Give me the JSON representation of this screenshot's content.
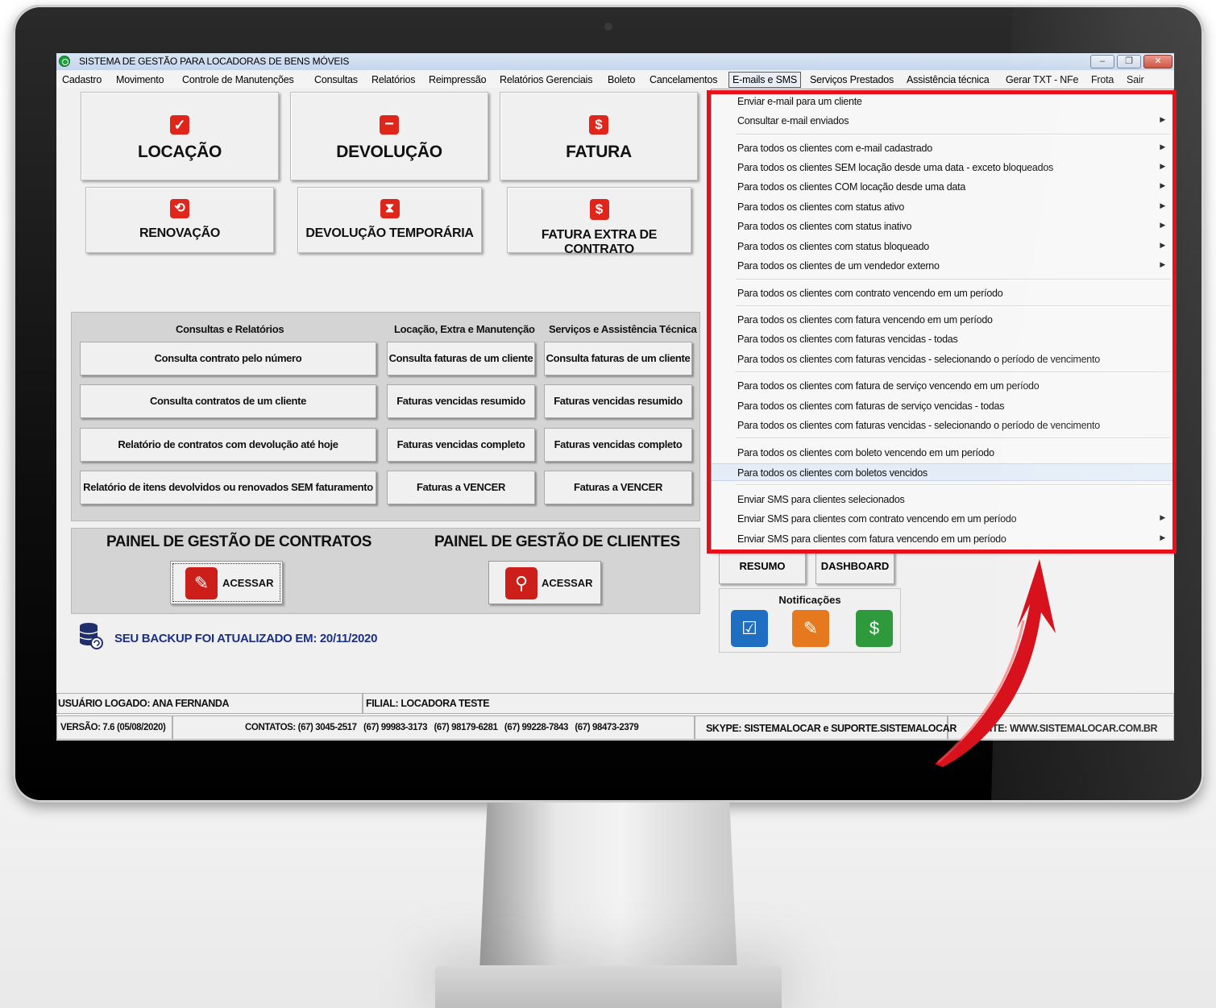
{
  "window": {
    "title": "SISTEMA DE GESTÃO PARA LOCADORAS DE BENS MÓVEIS"
  },
  "menu": [
    "Cadastro",
    "Movimento",
    "Controle de Manutenções",
    "Consultas",
    "Relatórios",
    "Reimpressão",
    "Relatórios Gerenciais",
    "Boleto",
    "Cancelamentos",
    "E-mails e SMS",
    "Serviços Prestados",
    "Assistência técnica",
    "Gerar TXT - NFe",
    "Frota",
    "Sair"
  ],
  "big_buttons": [
    "LOCAÇÃO",
    "DEVOLUÇÃO",
    "FATURA"
  ],
  "mid_buttons": [
    "RENOVAÇÃO",
    "DEVOLUÇÃO TEMPORÁRIA",
    "FATURA EXTRA DE CONTRATO"
  ],
  "icons_text": {
    "fatura": "$"
  },
  "consultas": {
    "columns": [
      "Consultas e Relatórios",
      "Locação, Extra e Manutenção",
      "Serviços e Assistência Técnica"
    ],
    "col1": [
      "Consulta contrato pelo número",
      "Consulta contratos de um cliente",
      "Relatório de contratos com devolução até hoje",
      "Relatório de itens devolvidos ou renovados SEM faturamento"
    ],
    "col2": [
      "Consulta faturas de um cliente",
      "Faturas vencidas resumido",
      "Faturas vencidas completo",
      "Faturas a VENCER"
    ],
    "col3": [
      "Consulta faturas de um cliente",
      "Faturas vencidas resumido",
      "Faturas vencidas completo",
      "Faturas a VENCER"
    ]
  },
  "panels": {
    "contratos_title": "PAINEL DE GESTÃO DE CONTRATOS",
    "clientes_title": "PAINEL DE GESTÃO DE CLIENTES",
    "access_label": "ACESSAR"
  },
  "backup": "SEU BACKUP FOI ATUALIZADO EM: 20/11/2020",
  "side": {
    "resumo": "RESUMO",
    "dashboard": "DASHBOARD",
    "notificacoes": "Notificações"
  },
  "status": {
    "usuario": "USUÁRIO LOGADO: ANA FERNANDA",
    "filial": "FILIAL: LOCADORA TESTE",
    "versao": "VERSÃO: 7.6 (05/08/2020)",
    "contatos": "CONTATOS: (67) 3045-2517   (67) 99983-3173   (67) 98179-6281   (67) 99228-7843   (67) 98473-2379",
    "skype": "SKYPE: SISTEMALOCAR e SUPORTE.SISTEMALOCAR",
    "site": "SITE: WWW.SISTEMALOCAR.COM.BR"
  },
  "dropdown": [
    {
      "label": "Enviar e-mail para um cliente",
      "sub": false
    },
    {
      "label": "Consultar e-mail enviados",
      "sub": true
    },
    {
      "label": "Para todos os clientes com e-mail cadastrado",
      "sub": true
    },
    {
      "label": "Para todos os clientes SEM locação desde uma data - exceto bloqueados",
      "sub": true
    },
    {
      "label": "Para todos os clientes COM locação desde uma data",
      "sub": true
    },
    {
      "label": "Para todos os clientes com status ativo",
      "sub": true
    },
    {
      "label": "Para todos os clientes com status inativo",
      "sub": true
    },
    {
      "label": "Para todos os clientes com status bloqueado",
      "sub": true
    },
    {
      "label": "Para todos os clientes de um vendedor externo",
      "sub": true
    },
    {
      "label": "Para todos os clientes com contrato vencendo em um período",
      "sub": false
    },
    {
      "label": "Para todos os clientes com fatura vencendo em um período",
      "sub": false
    },
    {
      "label": "Para todos os clientes com faturas vencidas - todas",
      "sub": false
    },
    {
      "label": "Para todos os clientes com faturas vencidas - selecionando o período de vencimento",
      "sub": false
    },
    {
      "label": "Para todos os clientes com fatura de serviço vencendo em um período",
      "sub": false
    },
    {
      "label": "Para todos os clientes com faturas de serviço vencidas - todas",
      "sub": false
    },
    {
      "label": "Para todos os clientes com faturas vencidas - selecionando o período de vencimento",
      "sub": false
    },
    {
      "label": "Para todos os clientes com boleto vencendo em um período",
      "sub": false
    },
    {
      "label": "Para todos os clientes com boletos vencidos",
      "sub": false,
      "highlighted": true
    },
    {
      "label": "Enviar SMS para clientes selecionados",
      "sub": false
    },
    {
      "label": "Enviar SMS para clientes com contrato vencendo em um período",
      "sub": true
    },
    {
      "label": "Enviar SMS para clientes com fatura vencendo em um período",
      "sub": true
    }
  ],
  "colors": {
    "accent_red": "#e0251b",
    "highlight_red": "#e8101a",
    "backup_blue": "#1c2f8a"
  }
}
